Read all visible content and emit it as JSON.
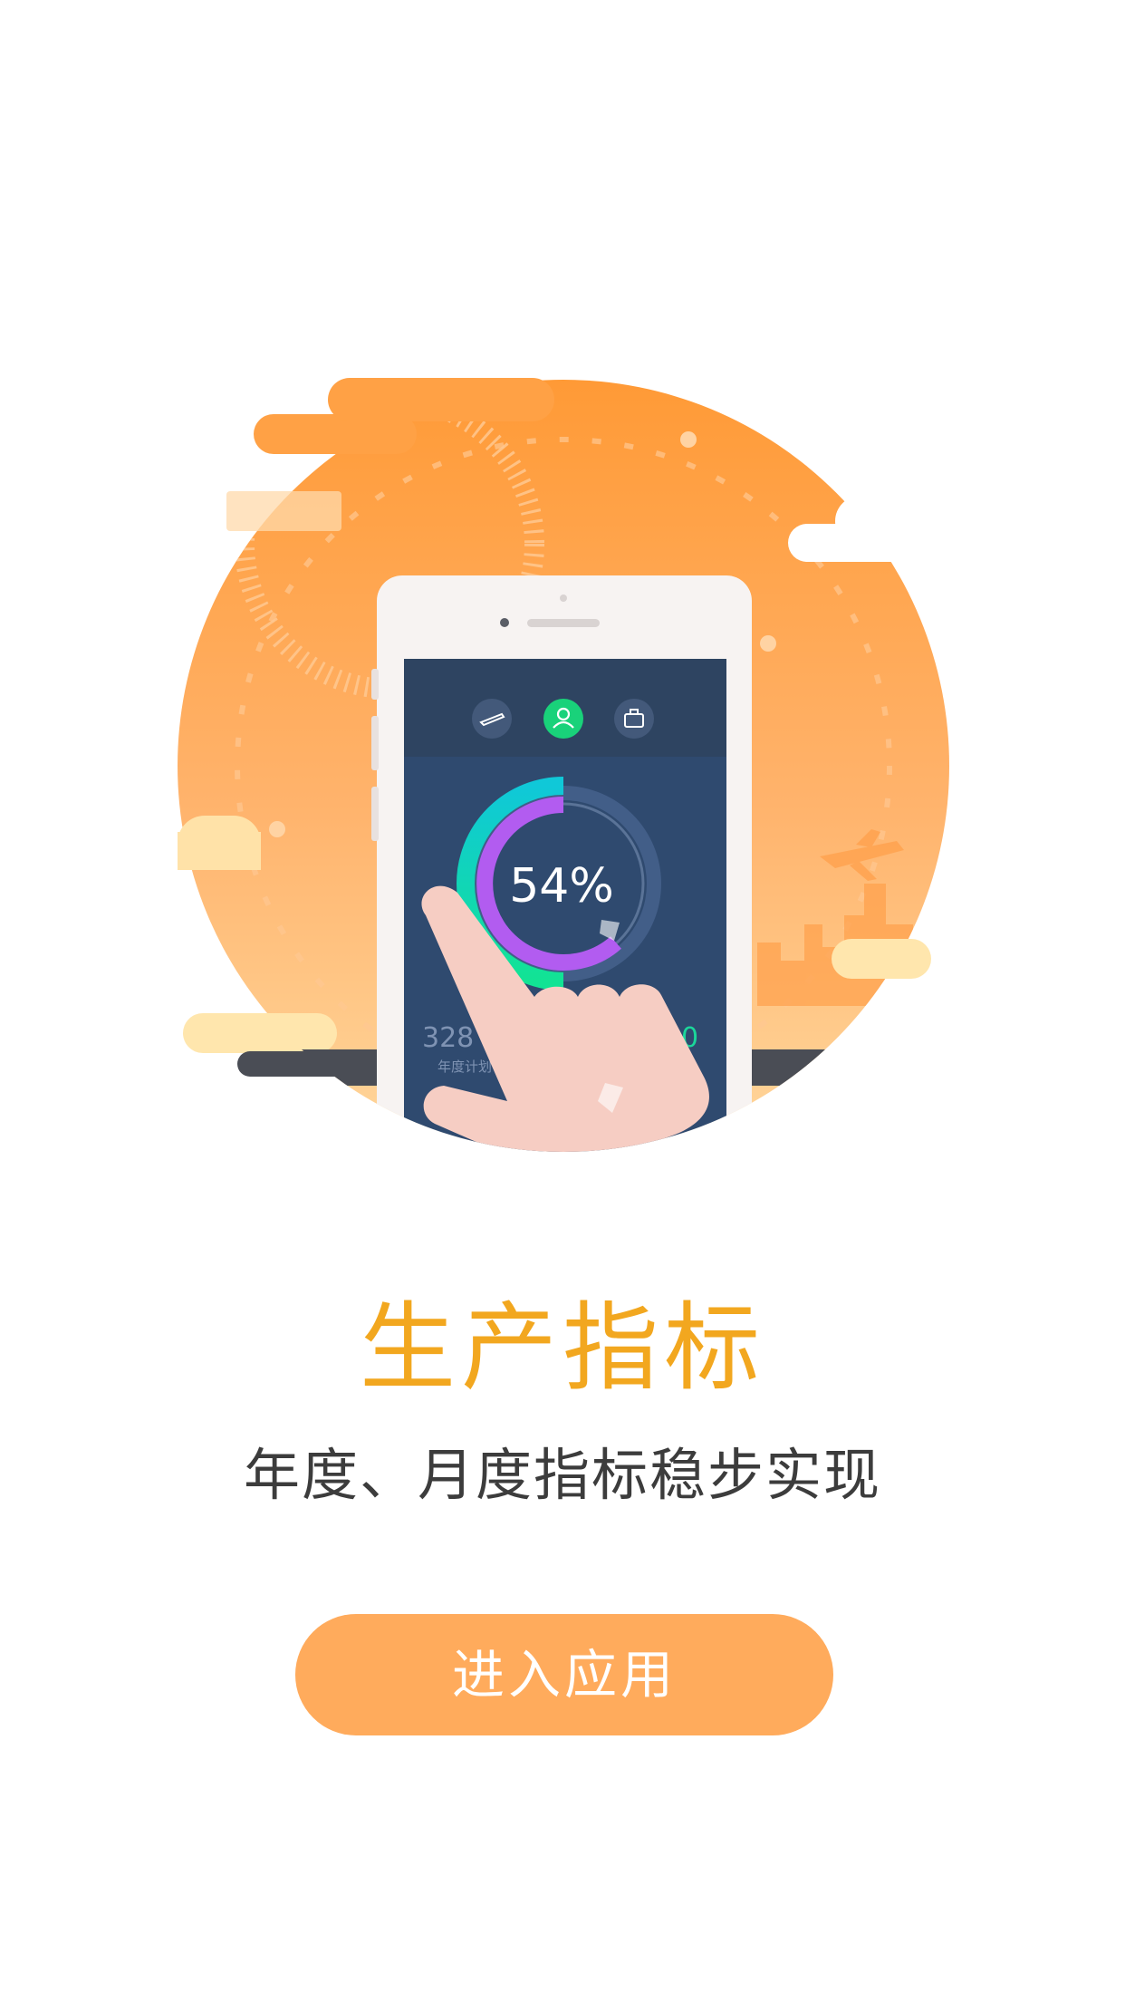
{
  "intro": {
    "title": "生产指标",
    "subtitle": "年度、月度指标稳步实现",
    "enter_button_label": "进入应用"
  },
  "illustration": {
    "phone_screen": {
      "percent_label": "54%",
      "stat_left_value": "328",
      "stat_left_caption": "年度计划",
      "stat_right_value": "0",
      "tab_icons": [
        "plane-icon",
        "user-icon",
        "briefcase-icon"
      ],
      "active_tab": "user-icon"
    },
    "colors": {
      "sun_top": "#ff9933",
      "sun_bottom": "#ffb470",
      "screen_bg": "#2f4a6f",
      "screen_header": "#2e4461",
      "active_tab": "#19d27a",
      "ring_outer": "#1bd69a",
      "ring_inner": "#b25cf0",
      "hand": "#f6cdc3",
      "title": "#f2a71f",
      "button": "#ffab5c"
    }
  }
}
